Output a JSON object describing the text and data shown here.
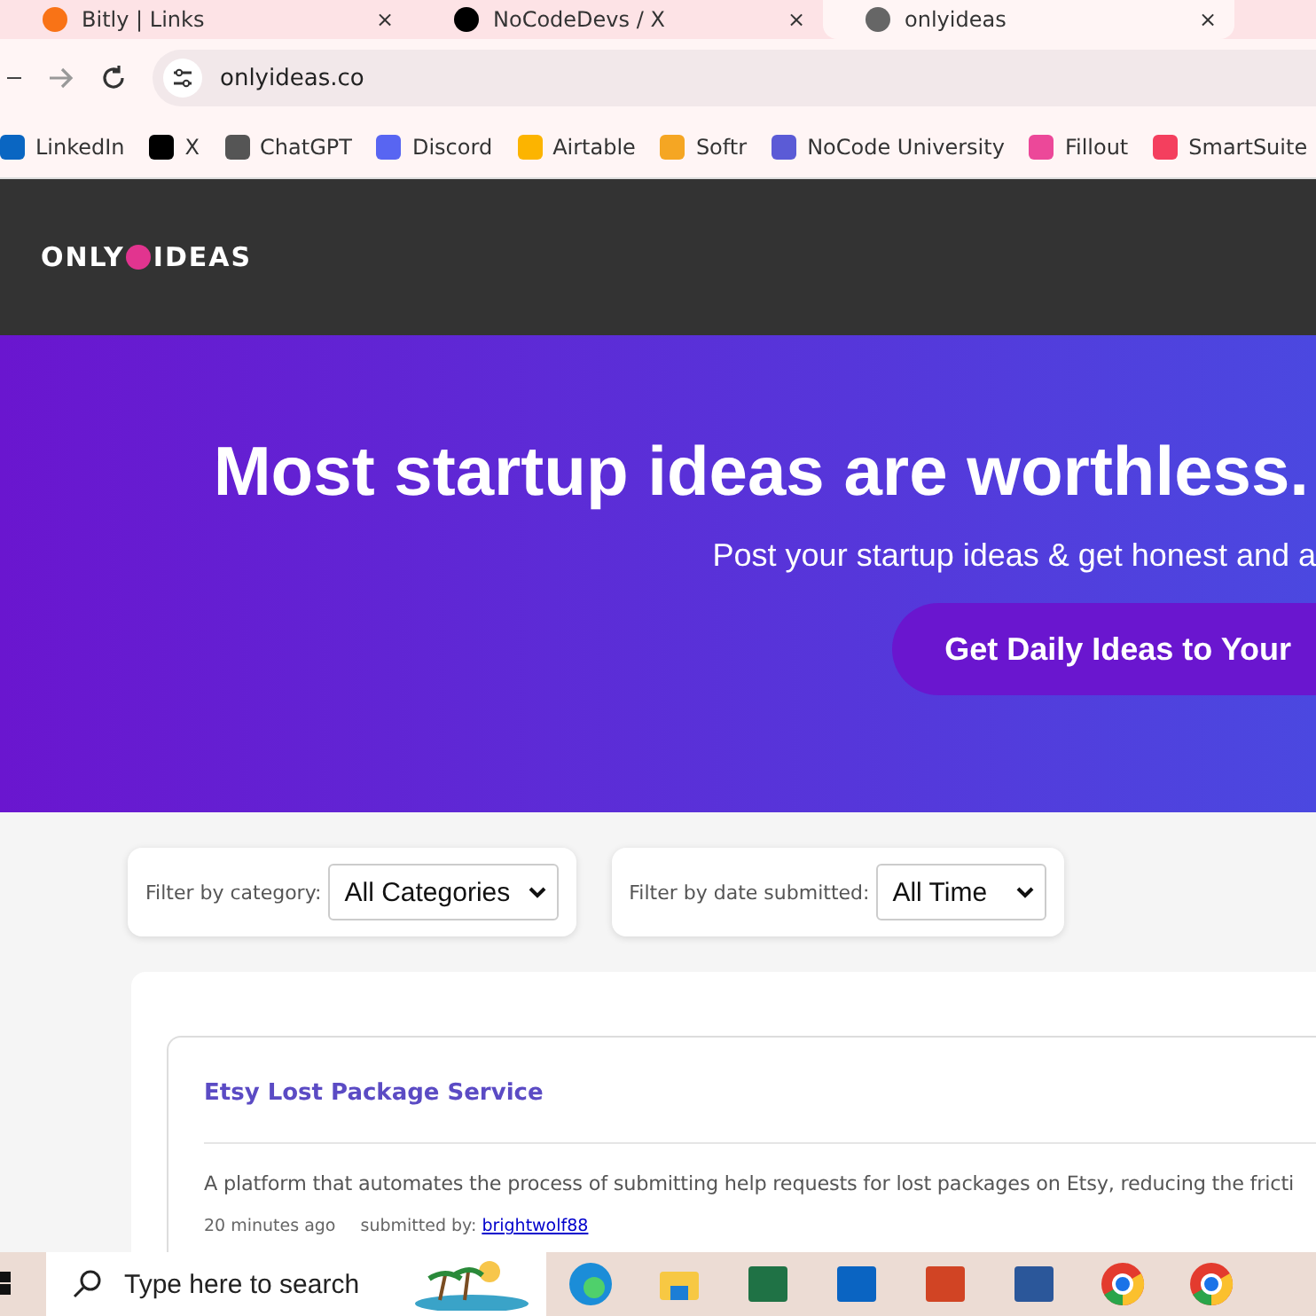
{
  "tabs": [
    {
      "title": "Bitly | Links",
      "close": "×",
      "selected": false
    },
    {
      "title": "NoCodeDevs / X",
      "close": "×",
      "selected": false
    },
    {
      "title": "onlyideas",
      "close": "×",
      "selected": true
    }
  ],
  "address_bar": {
    "url": "onlyideas.co"
  },
  "bookmarks": [
    "LinkedIn",
    "X",
    "ChatGPT",
    "Discord",
    "Airtable",
    "Softr",
    "NoCode University",
    "Fillout",
    "SmartSuite"
  ],
  "site_header": {
    "logo_left": "ONLY",
    "logo_right": "IDEAS"
  },
  "hero": {
    "title": "Most startup ideas are worthless.",
    "subtitle": "Post your startup ideas & get honest and a",
    "button": "Get Daily Ideas to Your"
  },
  "filters": [
    {
      "label": "Filter by category:",
      "value": "All Categories"
    },
    {
      "label": "Filter by date submitted:",
      "value": "All Time"
    }
  ],
  "ideas": [
    {
      "title": "Etsy Lost Package Service",
      "description": "A platform that automates the process of submitting help requests for lost packages on Etsy, reducing the fricti",
      "time": "20 minutes ago",
      "submitted_label": "submitted by:",
      "author": "brightwolf88"
    }
  ],
  "taskbar": {
    "search_placeholder": "Type here to search"
  }
}
